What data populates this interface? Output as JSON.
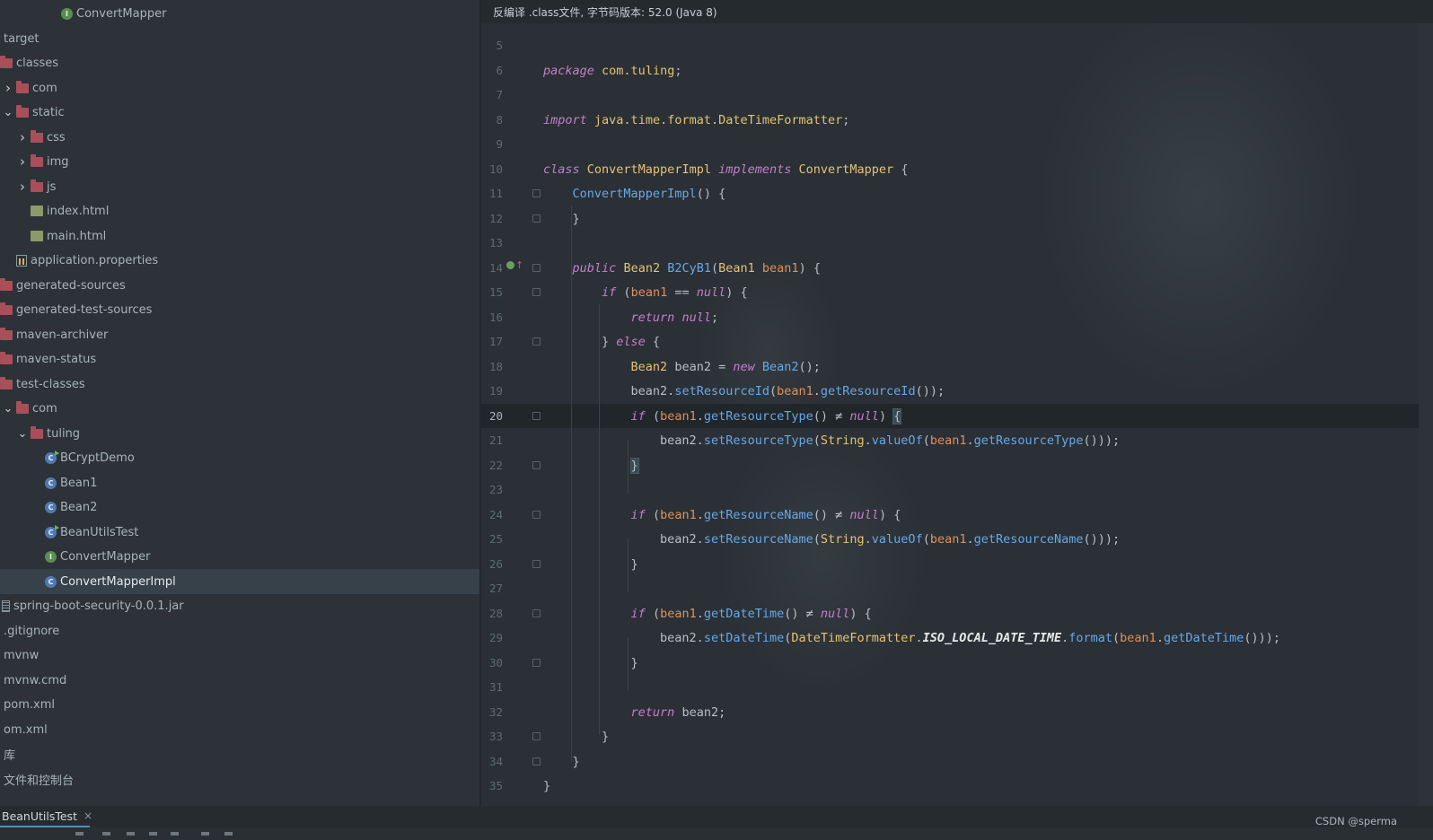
{
  "project_tree": {
    "items": [
      {
        "label": "ConvertMapper",
        "icon": "interface-icon",
        "chevron": ""
      },
      {
        "label": "target",
        "icon": "",
        "chevron": ""
      },
      {
        "label": "classes",
        "icon": "folder-icon",
        "chevron": ""
      },
      {
        "label": "com",
        "icon": "folder-icon",
        "chevron": "collapsed"
      },
      {
        "label": "static",
        "icon": "folder-icon",
        "chevron": "expanded"
      },
      {
        "label": "css",
        "icon": "folder-icon",
        "chevron": "collapsed"
      },
      {
        "label": "img",
        "icon": "folder-icon",
        "chevron": "collapsed"
      },
      {
        "label": "js",
        "icon": "folder-icon",
        "chevron": "collapsed"
      },
      {
        "label": "index.html",
        "icon": "html-file-icon",
        "chevron": ""
      },
      {
        "label": "main.html",
        "icon": "html-file-icon",
        "chevron": ""
      },
      {
        "label": "application.properties",
        "icon": "properties-file-icon",
        "chevron": ""
      },
      {
        "label": "generated-sources",
        "icon": "folder-icon",
        "chevron": ""
      },
      {
        "label": "generated-test-sources",
        "icon": "folder-icon",
        "chevron": ""
      },
      {
        "label": "maven-archiver",
        "icon": "folder-icon",
        "chevron": ""
      },
      {
        "label": "maven-status",
        "icon": "folder-icon",
        "chevron": ""
      },
      {
        "label": "test-classes",
        "icon": "folder-icon",
        "chevron": ""
      },
      {
        "label": "com",
        "icon": "folder-icon",
        "chevron": "expanded"
      },
      {
        "label": "tuling",
        "icon": "folder-icon",
        "chevron": "expanded"
      },
      {
        "label": "BCryptDemo",
        "icon": "runnable-class-icon",
        "chevron": ""
      },
      {
        "label": "Bean1",
        "icon": "class-icon",
        "chevron": ""
      },
      {
        "label": "Bean2",
        "icon": "class-icon",
        "chevron": ""
      },
      {
        "label": "BeanUtilsTest",
        "icon": "runnable-class-icon",
        "chevron": ""
      },
      {
        "label": "ConvertMapper",
        "icon": "interface-icon",
        "chevron": ""
      },
      {
        "label": "ConvertMapperImpl",
        "icon": "class-icon",
        "chevron": "",
        "selected": true
      },
      {
        "label": "spring-boot-security-0.0.1.jar",
        "icon": "jar-file-icon",
        "chevron": ""
      },
      {
        "label": ".gitignore",
        "icon": "",
        "chevron": ""
      },
      {
        "label": "mvnw",
        "icon": "",
        "chevron": ""
      },
      {
        "label": "mvnw.cmd",
        "icon": "",
        "chevron": ""
      },
      {
        "label": "pom.xml",
        "icon": "",
        "chevron": ""
      },
      {
        "label": "om.xml",
        "icon": "",
        "chevron": ""
      },
      {
        "label": "库",
        "icon": "",
        "chevron": ""
      },
      {
        "label": "文件和控制台",
        "icon": "",
        "chevron": ""
      }
    ]
  },
  "editor": {
    "banner": "反编译 .class文件, 字节码版本: 52.0 (Java 8)",
    "current_line": 20,
    "lines": [
      {
        "n": "5",
        "tokens": []
      },
      {
        "n": "6",
        "tokens": [
          [
            "kw",
            "package"
          ],
          [
            "pl",
            " "
          ],
          [
            "st",
            "com.tuling"
          ],
          [
            "pl",
            ";"
          ]
        ]
      },
      {
        "n": "7",
        "tokens": []
      },
      {
        "n": "8",
        "tokens": [
          [
            "kw",
            "import"
          ],
          [
            "pl",
            " "
          ],
          [
            "st",
            "java.time.format.DateTimeFormatter"
          ],
          [
            "pl",
            ";"
          ]
        ]
      },
      {
        "n": "9",
        "tokens": []
      },
      {
        "n": "10",
        "tokens": [
          [
            "kw",
            "class"
          ],
          [
            "pl",
            " "
          ],
          [
            "ty",
            "ConvertMapperImpl"
          ],
          [
            "pl",
            " "
          ],
          [
            "kw",
            "implements"
          ],
          [
            "pl",
            " "
          ],
          [
            "ty",
            "ConvertMapper"
          ],
          [
            "pl",
            " {"
          ]
        ]
      },
      {
        "n": "11",
        "tokens": [
          [
            "pl",
            "    "
          ],
          [
            "fn",
            "ConvertMapperImpl"
          ],
          [
            "pl",
            "() {"
          ]
        ]
      },
      {
        "n": "12",
        "tokens": [
          [
            "pl",
            "    }"
          ]
        ]
      },
      {
        "n": "13",
        "tokens": []
      },
      {
        "n": "14",
        "tokens": [
          [
            "pl",
            "    "
          ],
          [
            "kw",
            "public"
          ],
          [
            "pl",
            " "
          ],
          [
            "ty",
            "Bean2"
          ],
          [
            "pl",
            " "
          ],
          [
            "fn",
            "B2CyB1"
          ],
          [
            "pl",
            "("
          ],
          [
            "ty",
            "Bean1"
          ],
          [
            "pl",
            " "
          ],
          [
            "pm",
            "bean1"
          ],
          [
            "pl",
            ") {"
          ]
        ]
      },
      {
        "n": "15",
        "tokens": [
          [
            "pl",
            "        "
          ],
          [
            "kw",
            "if"
          ],
          [
            "pl",
            " ("
          ],
          [
            "pm",
            "bean1"
          ],
          [
            "pl",
            " == "
          ],
          [
            "kw",
            "null"
          ],
          [
            "pl",
            ") {"
          ]
        ]
      },
      {
        "n": "16",
        "tokens": [
          [
            "pl",
            "            "
          ],
          [
            "kw",
            "return"
          ],
          [
            "pl",
            " "
          ],
          [
            "kw",
            "null"
          ],
          [
            "pl",
            ";"
          ]
        ]
      },
      {
        "n": "17",
        "tokens": [
          [
            "pl",
            "        } "
          ],
          [
            "kw",
            "else"
          ],
          [
            "pl",
            " {"
          ]
        ]
      },
      {
        "n": "18",
        "tokens": [
          [
            "pl",
            "            "
          ],
          [
            "ty",
            "Bean2"
          ],
          [
            "pl",
            " bean2 = "
          ],
          [
            "kw",
            "new"
          ],
          [
            "pl",
            " "
          ],
          [
            "fn",
            "Bean2"
          ],
          [
            "pl",
            "();"
          ]
        ]
      },
      {
        "n": "19",
        "tokens": [
          [
            "pl",
            "            bean2."
          ],
          [
            "fn",
            "setResourceId"
          ],
          [
            "pl",
            "("
          ],
          [
            "pm",
            "bean1"
          ],
          [
            "pl",
            "."
          ],
          [
            "fn",
            "getResourceId"
          ],
          [
            "pl",
            "());"
          ]
        ]
      },
      {
        "n": "20",
        "tokens": [
          [
            "pl",
            "            "
          ],
          [
            "kw",
            "if"
          ],
          [
            "pl",
            " ("
          ],
          [
            "pm",
            "bean1"
          ],
          [
            "pl",
            "."
          ],
          [
            "fn",
            "getResourceType"
          ],
          [
            "pl",
            "() ≠ "
          ],
          [
            "kw",
            "null"
          ],
          [
            "pl",
            ") "
          ],
          [
            "hl",
            "{"
          ]
        ]
      },
      {
        "n": "21",
        "tokens": [
          [
            "pl",
            "                bean2."
          ],
          [
            "fn",
            "setResourceType"
          ],
          [
            "pl",
            "("
          ],
          [
            "ty",
            "String"
          ],
          [
            "pl",
            "."
          ],
          [
            "fn",
            "valueOf"
          ],
          [
            "pl",
            "("
          ],
          [
            "pm",
            "bean1"
          ],
          [
            "pl",
            "."
          ],
          [
            "fn",
            "getResourceType"
          ],
          [
            "pl",
            "()));"
          ]
        ]
      },
      {
        "n": "22",
        "tokens": [
          [
            "pl",
            "            "
          ],
          [
            "hl",
            "}"
          ]
        ]
      },
      {
        "n": "23",
        "tokens": []
      },
      {
        "n": "24",
        "tokens": [
          [
            "pl",
            "            "
          ],
          [
            "kw",
            "if"
          ],
          [
            "pl",
            " ("
          ],
          [
            "pm",
            "bean1"
          ],
          [
            "pl",
            "."
          ],
          [
            "fn",
            "getResourceName"
          ],
          [
            "pl",
            "() ≠ "
          ],
          [
            "kw",
            "null"
          ],
          [
            "pl",
            ") {"
          ]
        ]
      },
      {
        "n": "25",
        "tokens": [
          [
            "pl",
            "                bean2."
          ],
          [
            "fn",
            "setResourceName"
          ],
          [
            "pl",
            "("
          ],
          [
            "ty",
            "String"
          ],
          [
            "pl",
            "."
          ],
          [
            "fn",
            "valueOf"
          ],
          [
            "pl",
            "("
          ],
          [
            "pm",
            "bean1"
          ],
          [
            "pl",
            "."
          ],
          [
            "fn",
            "getResourceName"
          ],
          [
            "pl",
            "()));"
          ]
        ]
      },
      {
        "n": "26",
        "tokens": [
          [
            "pl",
            "            }"
          ]
        ]
      },
      {
        "n": "27",
        "tokens": []
      },
      {
        "n": "28",
        "tokens": [
          [
            "pl",
            "            "
          ],
          [
            "kw",
            "if"
          ],
          [
            "pl",
            " ("
          ],
          [
            "pm",
            "bean1"
          ],
          [
            "pl",
            "."
          ],
          [
            "fn",
            "getDateTime"
          ],
          [
            "pl",
            "() ≠ "
          ],
          [
            "kw",
            "null"
          ],
          [
            "pl",
            ") {"
          ]
        ]
      },
      {
        "n": "29",
        "tokens": [
          [
            "pl",
            "                bean2."
          ],
          [
            "fn",
            "setDateTime"
          ],
          [
            "pl",
            "("
          ],
          [
            "ty",
            "DateTimeFormatter"
          ],
          [
            "pl",
            "."
          ],
          [
            "cst",
            "ISO_LOCAL_DATE_TIME"
          ],
          [
            "pl",
            "."
          ],
          [
            "fn",
            "format"
          ],
          [
            "pl",
            "("
          ],
          [
            "pm",
            "bean1"
          ],
          [
            "pl",
            "."
          ],
          [
            "fn",
            "getDateTime"
          ],
          [
            "pl",
            "()));"
          ]
        ]
      },
      {
        "n": "30",
        "tokens": [
          [
            "pl",
            "            }"
          ]
        ]
      },
      {
        "n": "31",
        "tokens": []
      },
      {
        "n": "32",
        "tokens": [
          [
            "pl",
            "            "
          ],
          [
            "kw",
            "return"
          ],
          [
            "pl",
            " bean2;"
          ]
        ]
      },
      {
        "n": "33",
        "tokens": [
          [
            "pl",
            "        }"
          ]
        ]
      },
      {
        "n": "34",
        "tokens": [
          [
            "pl",
            "    }"
          ]
        ]
      },
      {
        "n": "35",
        "tokens": [
          [
            "pl",
            "}"
          ]
        ]
      }
    ]
  },
  "bottom": {
    "run_tab_label": "BeanUtilsTest",
    "close_glyph": "×",
    "watermark": "CSDN @sperma"
  },
  "colors": {
    "keyword": "#c77dcf",
    "type": "#e6c274",
    "method": "#68a8e8",
    "parameter": "#e0905a",
    "folder": "#a84f5a",
    "selection": "#37414a"
  }
}
